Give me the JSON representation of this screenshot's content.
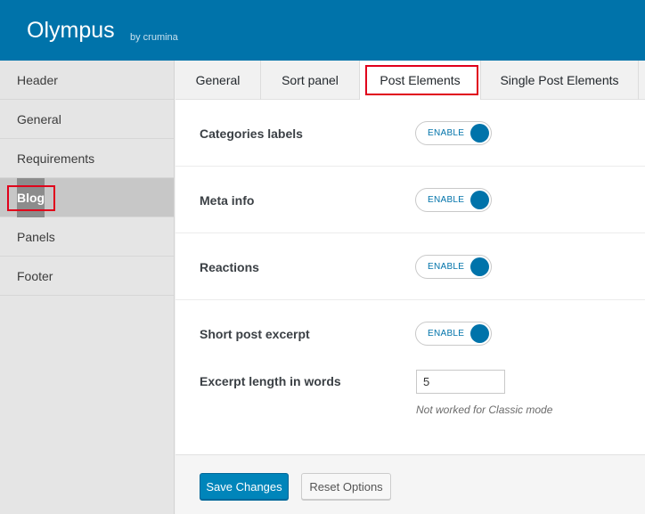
{
  "app": {
    "title": "Olympus",
    "byline": "by crumina"
  },
  "sidebar": {
    "items": [
      {
        "label": "Header"
      },
      {
        "label": "General"
      },
      {
        "label": "Requirements"
      },
      {
        "label": "Blog",
        "active": true
      },
      {
        "label": "Panels"
      },
      {
        "label": "Footer"
      }
    ]
  },
  "tabs": [
    {
      "label": "General"
    },
    {
      "label": "Sort panel"
    },
    {
      "label": "Post Elements",
      "active": true
    },
    {
      "label": "Single Post Elements"
    }
  ],
  "options": {
    "categories_labels": {
      "label": "Categories labels",
      "state": "ENABLE"
    },
    "meta_info": {
      "label": "Meta info",
      "state": "ENABLE"
    },
    "reactions": {
      "label": "Reactions",
      "state": "ENABLE"
    },
    "short_post_excerpt": {
      "label": "Short post excerpt",
      "state": "ENABLE"
    },
    "excerpt_length": {
      "label": "Excerpt length in words",
      "value": "5",
      "hint": "Not worked for Classic mode"
    }
  },
  "footer": {
    "save_label": "Save Changes",
    "reset_label": "Reset Options"
  },
  "colors": {
    "brand": "#0073aa",
    "highlight": "#e0001b",
    "primary_button": "#0085ba"
  }
}
